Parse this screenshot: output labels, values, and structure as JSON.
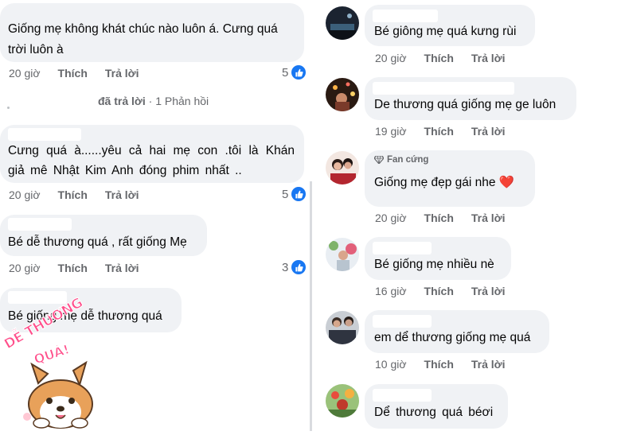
{
  "left": {
    "comments": [
      {
        "text": "Giống mẹ không khát chúc nào luôn á. Cưng quá trời luôn à",
        "time": "20 giờ",
        "like": "Thích",
        "reply": "Trả lời",
        "reactions": "5"
      },
      {
        "text": "Cưng quá à......yêu cả hai mẹ con .tôi là Khán giả mê Nhật Kim Anh đóng phim nhất ..",
        "time": "20 giờ",
        "like": "Thích",
        "reply": "Trả lời",
        "reactions": "5"
      },
      {
        "text": "Bé dễ thương quá , rất giống Mẹ",
        "time": "20 giờ",
        "like": "Thích",
        "reply": "Trả lời",
        "reactions": "3"
      },
      {
        "text": "Bé giống mẹ dễ thương quá"
      }
    ],
    "replies_link": {
      "prefix": "đã trả lời",
      "count": "· 1 Phản hồi"
    },
    "sticker": {
      "line1": "DỄ THƯƠNG",
      "line2": "QUÁ!"
    }
  },
  "right": {
    "comments": [
      {
        "text": "Bé giông mẹ quá kưng rùi",
        "time": "20 giờ",
        "like": "Thích",
        "reply": "Trả lời",
        "avatar": "avatar-night"
      },
      {
        "text": "De thương quá giống mẹ ge luôn",
        "time": "19 giờ",
        "like": "Thích",
        "reply": "Trả lời",
        "avatar": "avatar-lights"
      },
      {
        "badge": "Fan cứng",
        "text": "Giống mẹ đẹp gái nhe",
        "emoji": "❤️",
        "time": "20 giờ",
        "like": "Thích",
        "reply": "Trả lời",
        "avatar": "avatar-couple"
      },
      {
        "text": "Bé giống mẹ nhiều nè",
        "time": "16 giờ",
        "like": "Thích",
        "reply": "Trả lời",
        "avatar": "avatar-flowers"
      },
      {
        "text": "em dể thương giống mẹ quá",
        "time": "10 giờ",
        "like": "Thích",
        "reply": "Trả lời",
        "avatar": "avatar-people"
      },
      {
        "text": "Dể thương quá béơi",
        "avatar": "avatar-garden"
      }
    ]
  },
  "colors": {
    "bubble": "#f0f2f5",
    "meta": "#65676b",
    "like_blue": "#1877f2",
    "heart": "#e41e3f"
  }
}
